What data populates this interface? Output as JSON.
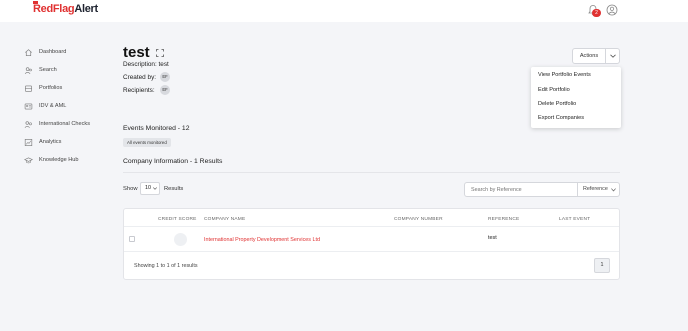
{
  "brand": {
    "name_red": "Red",
    "name_flag": "Flag",
    "name_alert": "Alert"
  },
  "topbar": {
    "notification_count": "2"
  },
  "sidebar": {
    "items": [
      {
        "label": "Dashboard",
        "icon": "home-icon"
      },
      {
        "label": "Search",
        "icon": "search-people-icon"
      },
      {
        "label": "Portfolios",
        "icon": "portfolio-icon"
      },
      {
        "label": "IDV & AML",
        "icon": "id-card-icon"
      },
      {
        "label": "International Checks",
        "icon": "international-people-icon"
      },
      {
        "label": "Analytics",
        "icon": "analytics-icon"
      },
      {
        "label": "Knowledge Hub",
        "icon": "graduation-cap-icon"
      }
    ]
  },
  "portfolio": {
    "title": "test",
    "description_label": "Description:",
    "description_value": "test",
    "created_by_label": "Created by:",
    "created_by_initials": "EF",
    "recipients_label": "Recipients:",
    "recipients_initials": "EF"
  },
  "actions": {
    "label": "Actions",
    "menu": [
      "View Portfolio Events",
      "Edit Portfolio",
      "Delete Portfolio",
      "Export Companies"
    ]
  },
  "events": {
    "heading": "Events Monitored - 12",
    "tag": "All events monitored"
  },
  "company_info": {
    "heading": "Company Information - 1 Results"
  },
  "controls": {
    "show_label": "Show",
    "page_size": "10",
    "results_label": "Results",
    "search_placeholder": "Search by Reference",
    "filter_value": "Reference"
  },
  "table": {
    "headers": [
      "CREDIT SCORE",
      "COMPANY NAME",
      "COMPANY NUMBER",
      "REFERENCE",
      "LAST EVENT"
    ],
    "rows": [
      {
        "company_name": "International Property Development Services Ltd",
        "company_number": "",
        "reference": "test",
        "last_event": ""
      }
    ],
    "showing_text": "Showing 1 to 1 of 1 results",
    "current_page": "1"
  },
  "colors": {
    "brand_red": "#e03131",
    "background": "#f4f5f8"
  }
}
